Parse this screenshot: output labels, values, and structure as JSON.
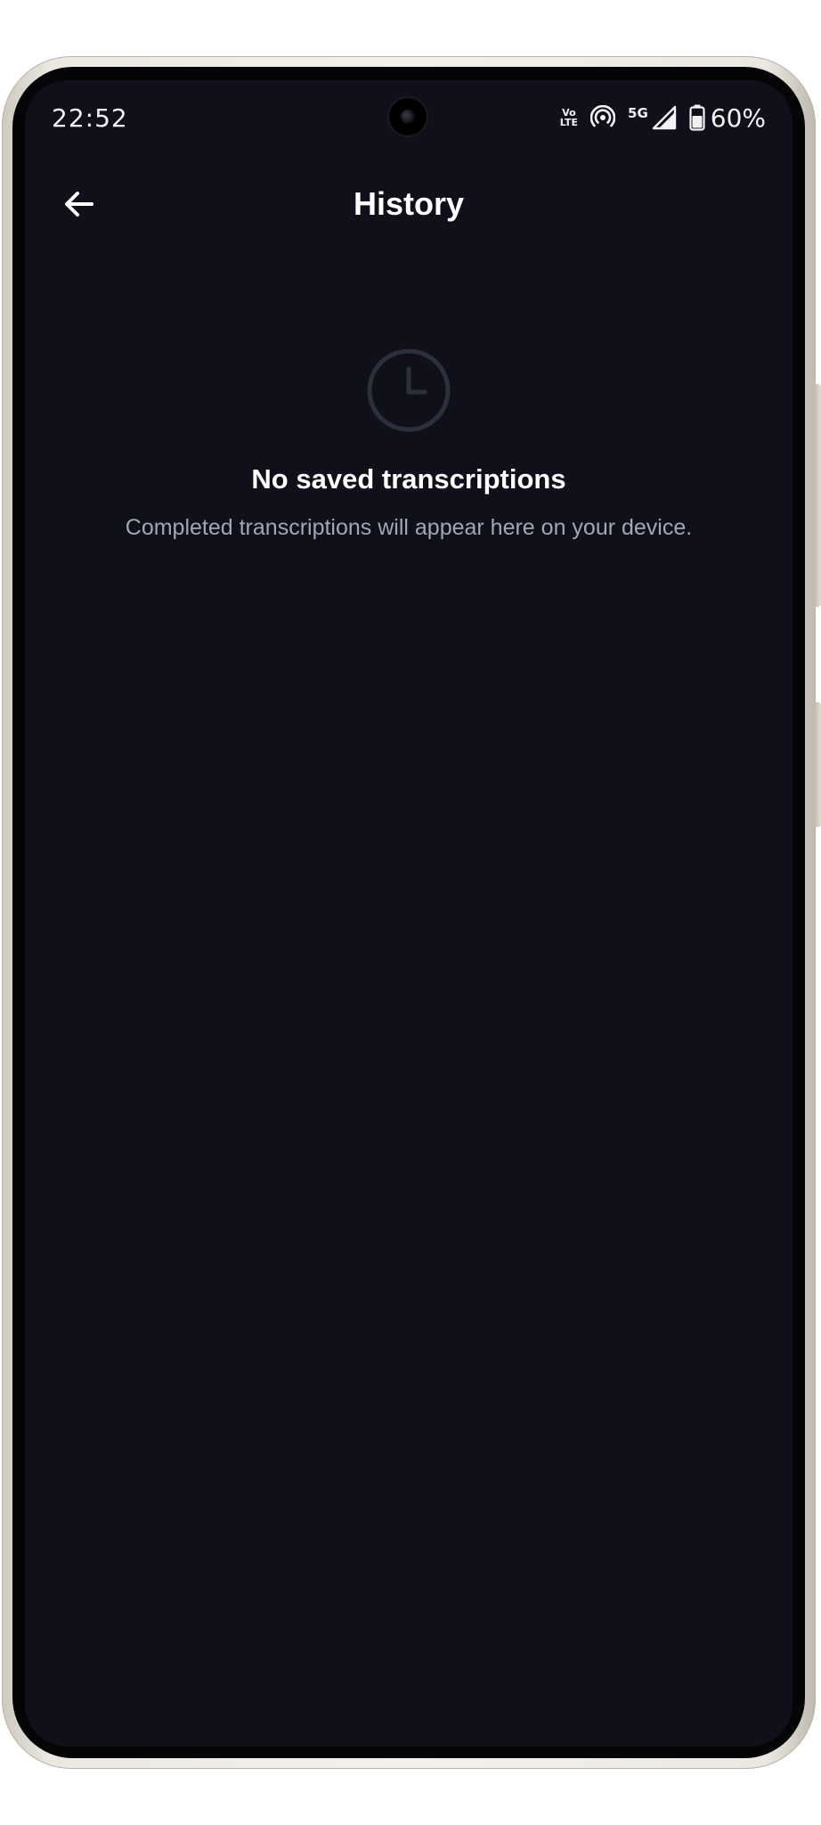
{
  "status_bar": {
    "time": "22:52",
    "volte_top": "Vo",
    "volte_bottom": "LTE",
    "network": "5G",
    "battery": "60%",
    "battery_level": 0.6,
    "icons": [
      "volte-icon",
      "hotspot-icon",
      "signal-icon",
      "battery-icon"
    ]
  },
  "app_bar": {
    "title": "History",
    "back_icon": "arrow-left-icon"
  },
  "empty_state": {
    "icon": "clock-icon",
    "title": "No saved transcriptions",
    "subtitle": "Completed transcriptions will appear here on your device."
  },
  "colors": {
    "background": "#0f1019",
    "text_primary": "#ffffff",
    "text_secondary": "#a4a6b3",
    "icon_muted": "#2d2f3b"
  }
}
